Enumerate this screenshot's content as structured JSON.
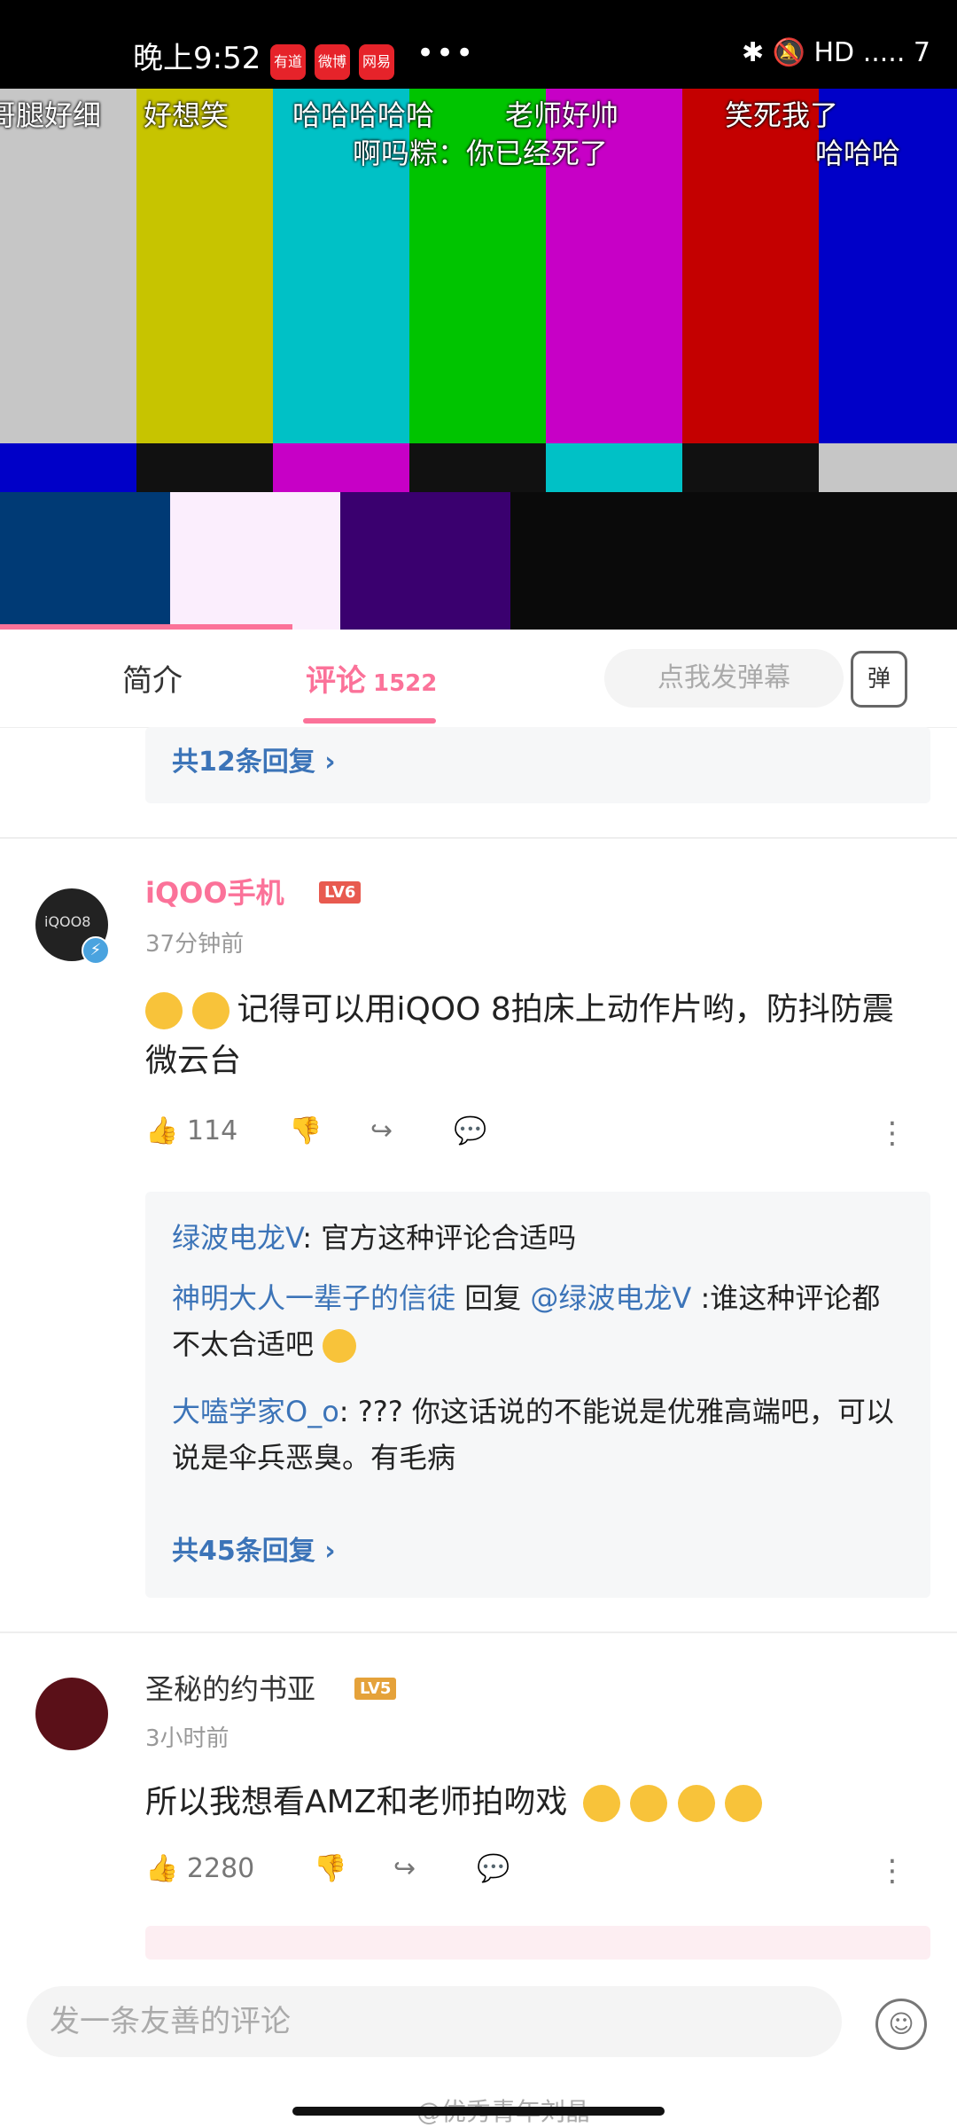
{
  "status_bar": {
    "time": "晚上9:52",
    "apps": [
      "有道",
      "微博",
      "网易"
    ],
    "more": "•••",
    "right": "✱ 🔕 HD ..... 7"
  },
  "video": {
    "danmaku": [
      "哥腿好细",
      "好想笑",
      "哈哈哈哈哈",
      "老师好帅",
      "笑死我了",
      "啊吗粽：你已经死了",
      "哈哈哈"
    ]
  },
  "tabs": {
    "intro": "简介",
    "comments": "评论",
    "comments_count": "1522",
    "danmu_placeholder": "点我发弹幕",
    "danmu_btn": "弹"
  },
  "prev_reply": {
    "more": "共12条回复 ›"
  },
  "comment1": {
    "username": "iQOO手机",
    "level": "LV6",
    "avatar_text": "iQOO8",
    "time": "37分钟前",
    "text": "记得可以用iQOO 8拍床上动作片哟，防抖防震微云台",
    "likes": "114",
    "replies": [
      {
        "name": "绿波电龙V",
        "text": ": 官方这种评论合适吗"
      },
      {
        "name": "神明大人一辈子的信徒",
        "mid": " 回复 ",
        "target": "@绿波电龙V",
        "text": " :谁这种评论都不太合适吧"
      },
      {
        "name": "大嗑学家O_o",
        "text": ": ??? 你这话说的不能说是优雅高端吧，可以说是伞兵恶臭。有毛病"
      }
    ],
    "more": "共45条回复 ›"
  },
  "comment2": {
    "username": "圣秘的约书亚",
    "level": "LV5",
    "time": "3小时前",
    "text": "所以我想看AMZ和老师拍吻戏",
    "likes": "2280"
  },
  "bottom": {
    "placeholder": "发一条友善的评论",
    "watermark": "@优秀青年刘晶"
  },
  "colors": {
    "accent": "#fb7299",
    "link": "#3c74b8"
  }
}
